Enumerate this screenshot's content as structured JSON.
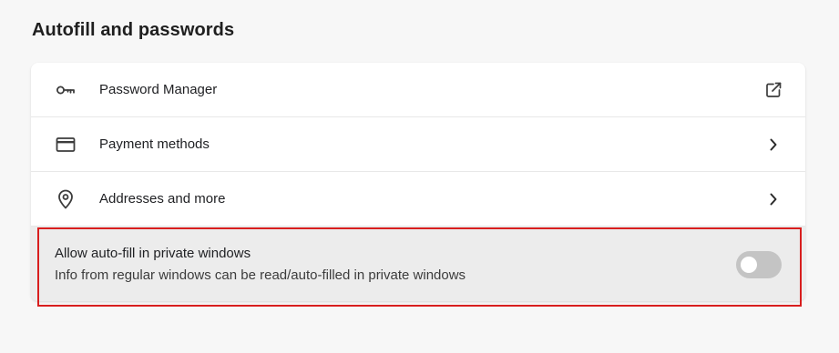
{
  "section": {
    "title": "Autofill and passwords"
  },
  "items": [
    {
      "label": "Password Manager",
      "icon": "key-icon",
      "trailing_icon": "open-external-icon"
    },
    {
      "label": "Payment methods",
      "icon": "credit-card-icon",
      "trailing_icon": "chevron-right-icon"
    },
    {
      "label": "Addresses and more",
      "icon": "location-pin-icon",
      "trailing_icon": "chevron-right-icon"
    }
  ],
  "private_autofill": {
    "title": "Allow auto-fill in private windows",
    "description": "Info from regular windows can be read/auto-filled in private windows",
    "enabled": false
  },
  "colors": {
    "background": "#f7f7f7",
    "card": "#ffffff",
    "toggle_row_bg": "#ececec",
    "switch_off": "#c4c4c4",
    "highlight_border": "#d81e1e"
  }
}
